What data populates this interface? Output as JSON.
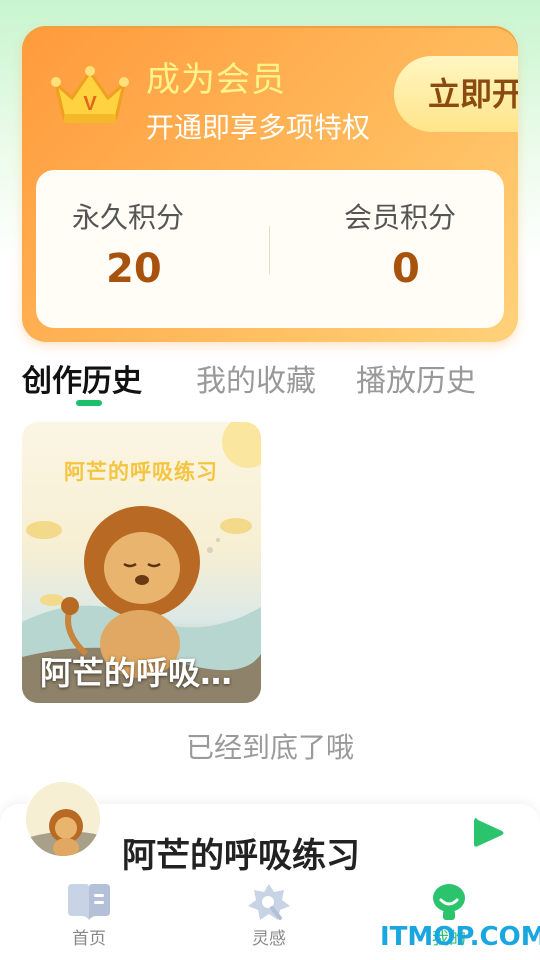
{
  "vip": {
    "title": "成为会员",
    "subtitle": "开通即享多项特权",
    "button_label": "立即开通",
    "crown_icon_letter": "V",
    "points": [
      {
        "label": "永久积分",
        "value": "20"
      },
      {
        "label": "会员积分",
        "value": "0"
      }
    ]
  },
  "tabs": [
    {
      "label": "创作历史",
      "active": true
    },
    {
      "label": "我的收藏",
      "active": false
    },
    {
      "label": "播放历史",
      "active": false
    }
  ],
  "works": [
    {
      "art_title": "阿芒的呼吸练习",
      "caption": "阿芒的呼吸练习"
    }
  ],
  "list_end_text": "已经到底了哦",
  "player": {
    "title": "阿芒的呼吸练习",
    "play_icon": "play-icon"
  },
  "nav": [
    {
      "label": "首页",
      "icon": "book-icon"
    },
    {
      "label": "灵感",
      "icon": "inspiration-icon"
    },
    {
      "label": "我的",
      "icon": "profile-icon",
      "active": true
    }
  ],
  "watermark": "ITMOP.COM",
  "colors": {
    "accent_green": "#1dbf6a",
    "vip_orange": "#ff9a3c",
    "points_value": "#a8530d"
  }
}
